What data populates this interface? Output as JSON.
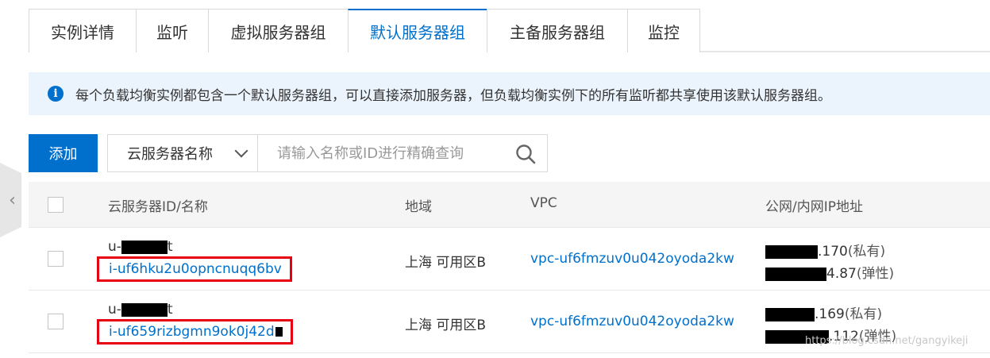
{
  "tabs": [
    {
      "label": "实例详情",
      "active": false
    },
    {
      "label": "监听",
      "active": false
    },
    {
      "label": "虚拟服务器组",
      "active": false
    },
    {
      "label": "默认服务器组",
      "active": true
    },
    {
      "label": "主备服务器组",
      "active": false
    },
    {
      "label": "监控",
      "active": false
    }
  ],
  "info": {
    "icon": "info-icon",
    "text": "每个负载均衡实例都包含一个默认服务器组，可以直接添加服务器，但负载均衡实例下的所有监听都共享使用该默认服务器组。"
  },
  "toolbar": {
    "add_label": "添加",
    "filter_selected": "云服务器名称",
    "search_placeholder": "请输入名称或ID进行精确查询"
  },
  "table": {
    "columns": [
      "云服务器ID/名称",
      "地域",
      "VPC",
      "公网/内网IP地址"
    ],
    "rows": [
      {
        "name_prefix": "u-",
        "name_suffix": "t",
        "id": "i-uf6hku2u0opncnuqq6bv",
        "region": "上海 可用区B",
        "vpc": "vpc-uf6fmzuv0u042oyoda2kw",
        "ip_private": ".170",
        "ip_private_label": "(私有)",
        "ip_public": "4.87",
        "ip_public_label": "(弹性)"
      },
      {
        "name_prefix": "u-",
        "name_suffix": "t",
        "id": "i-uf659rizbgmn9ok0j42d",
        "region": "上海 可用区B",
        "vpc": "vpc-uf6fmzuv0u042oyoda2kw",
        "ip_private": ".169",
        "ip_private_label": "(私有)",
        "ip_public": ".112",
        "ip_public_label": "(弹性)"
      }
    ]
  },
  "watermark": "https://blog.csdn.net/gangyikeji",
  "colors": {
    "accent": "#0070cc",
    "highlight": "#e60012",
    "banner": "#ebf3fc"
  }
}
